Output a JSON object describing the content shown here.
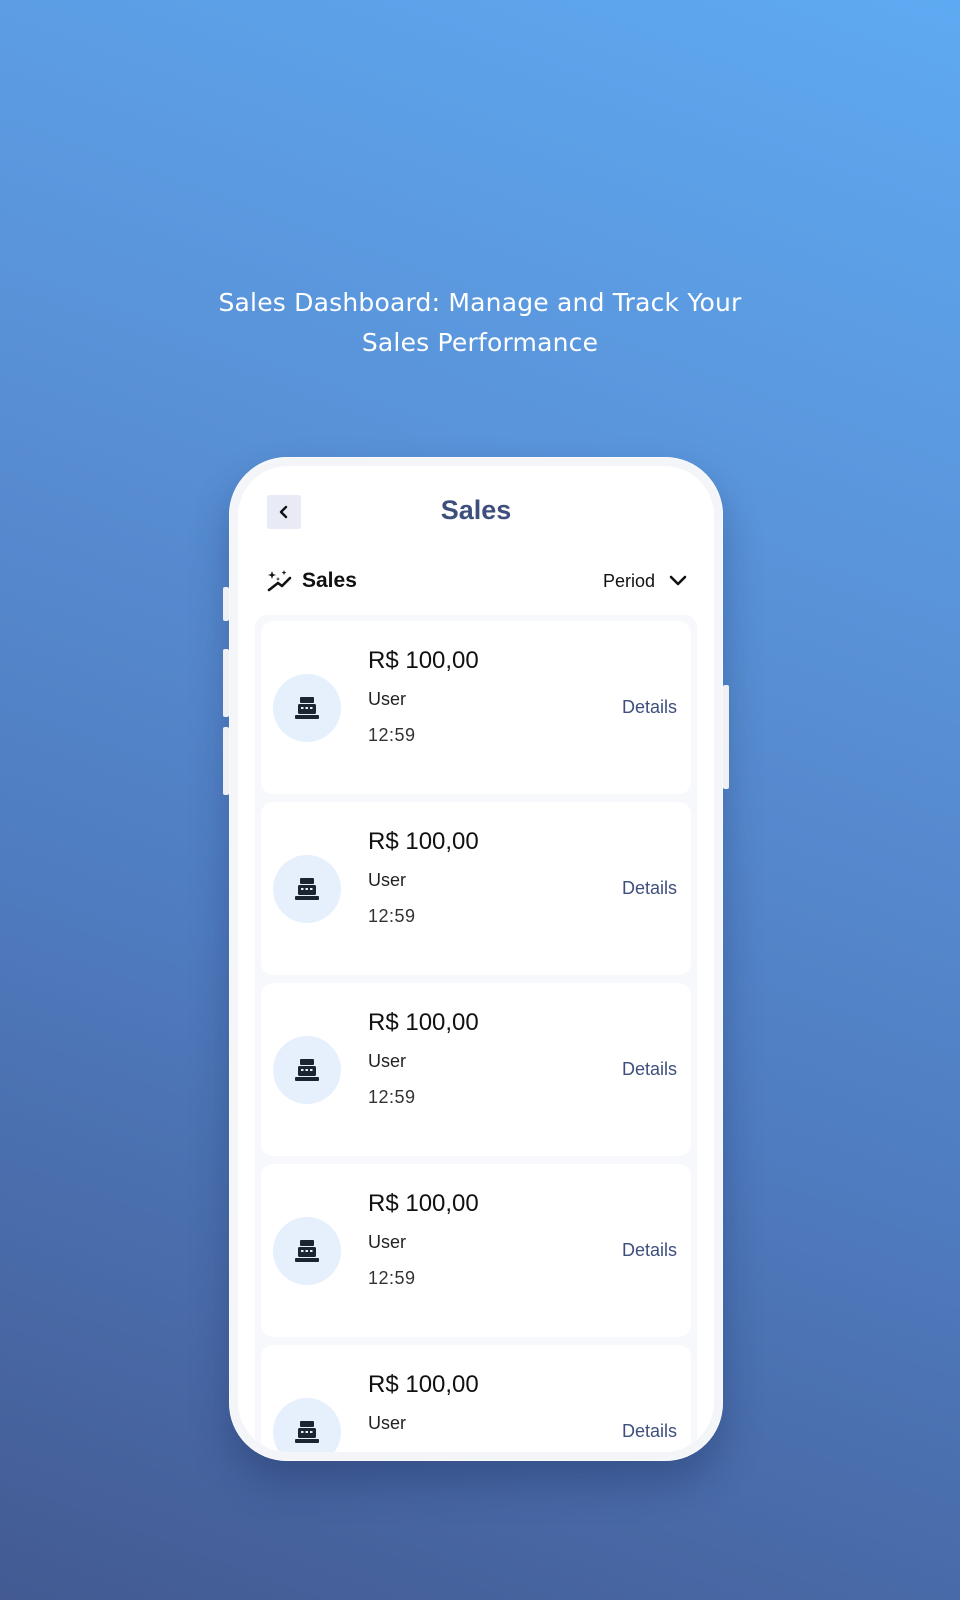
{
  "headline": {
    "line1": "Sales Dashboard: Manage and Track Your",
    "line2": "Sales Performance"
  },
  "screen": {
    "title": "Sales",
    "back_icon": "chevron-left-icon",
    "section": {
      "icon": "sparkles-icon",
      "label": "Sales"
    },
    "period_filter": {
      "label": "Period",
      "icon": "chevron-down-icon"
    }
  },
  "sales": [
    {
      "icon": "cash-register-icon",
      "amount": "R$ 100,00",
      "user": "User",
      "time": "12:59",
      "action": "Details"
    },
    {
      "icon": "cash-register-icon",
      "amount": "R$ 100,00",
      "user": "User",
      "time": "12:59",
      "action": "Details"
    },
    {
      "icon": "cash-register-icon",
      "amount": "R$ 100,00",
      "user": "User",
      "time": "12:59",
      "action": "Details"
    },
    {
      "icon": "cash-register-icon",
      "amount": "R$ 100,00",
      "user": "User",
      "time": "12:59",
      "action": "Details"
    },
    {
      "icon": "cash-register-icon",
      "amount": "R$ 100,00",
      "user": "User",
      "time": "",
      "action": "Details"
    }
  ],
  "colors": {
    "title": "#3e4f7d",
    "icon_circle": "#e6f0fd",
    "back_button": "#e8ebf6",
    "gradient_top": "#5eaaf2",
    "gradient_bottom": "#435a92"
  }
}
